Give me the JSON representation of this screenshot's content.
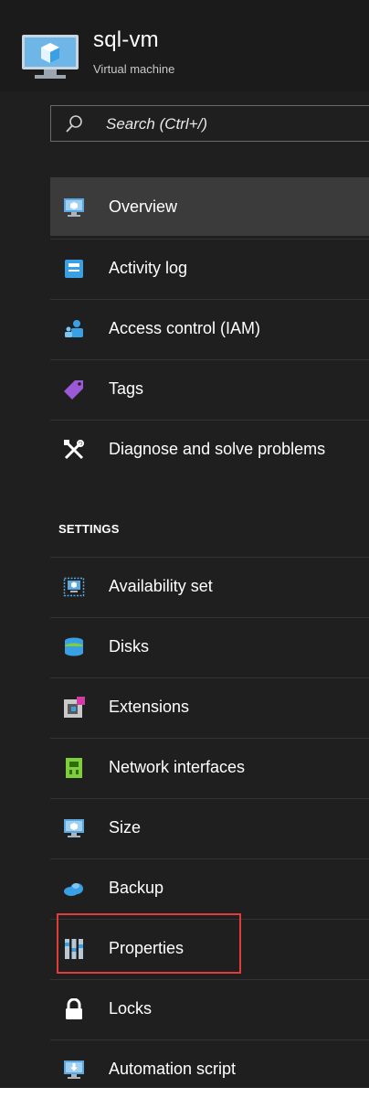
{
  "header": {
    "title": "sql-vm",
    "subtitle": "Virtual machine",
    "icon": "virtual-machine-icon"
  },
  "search": {
    "placeholder": "Search (Ctrl+/)",
    "icon": "search-icon"
  },
  "menu": {
    "items": [
      {
        "label": "Overview",
        "icon": "monitor-icon",
        "active": true
      },
      {
        "label": "Activity log",
        "icon": "activity-log-icon"
      },
      {
        "label": "Access control (IAM)",
        "icon": "users-icon"
      },
      {
        "label": "Tags",
        "icon": "tag-icon"
      },
      {
        "label": "Diagnose and solve problems",
        "icon": "wrench-icon"
      }
    ]
  },
  "settings": {
    "heading": "SETTINGS",
    "items": [
      {
        "label": "Availability set",
        "icon": "availability-set-icon"
      },
      {
        "label": "Disks",
        "icon": "disks-icon"
      },
      {
        "label": "Extensions",
        "icon": "extensions-icon"
      },
      {
        "label": "Network interfaces",
        "icon": "network-interface-icon"
      },
      {
        "label": "Size",
        "icon": "monitor-icon"
      },
      {
        "label": "Backup",
        "icon": "cloud-backup-icon"
      },
      {
        "label": "Properties",
        "icon": "properties-icon",
        "highlighted": true
      },
      {
        "label": "Locks",
        "icon": "lock-icon"
      },
      {
        "label": "Automation script",
        "icon": "download-monitor-icon"
      }
    ]
  },
  "colors": {
    "background": "#1f1f1f",
    "active_item": "#3b3b3b",
    "highlight_border": "#e23b3b",
    "accent_blue": "#3aa0e6"
  }
}
